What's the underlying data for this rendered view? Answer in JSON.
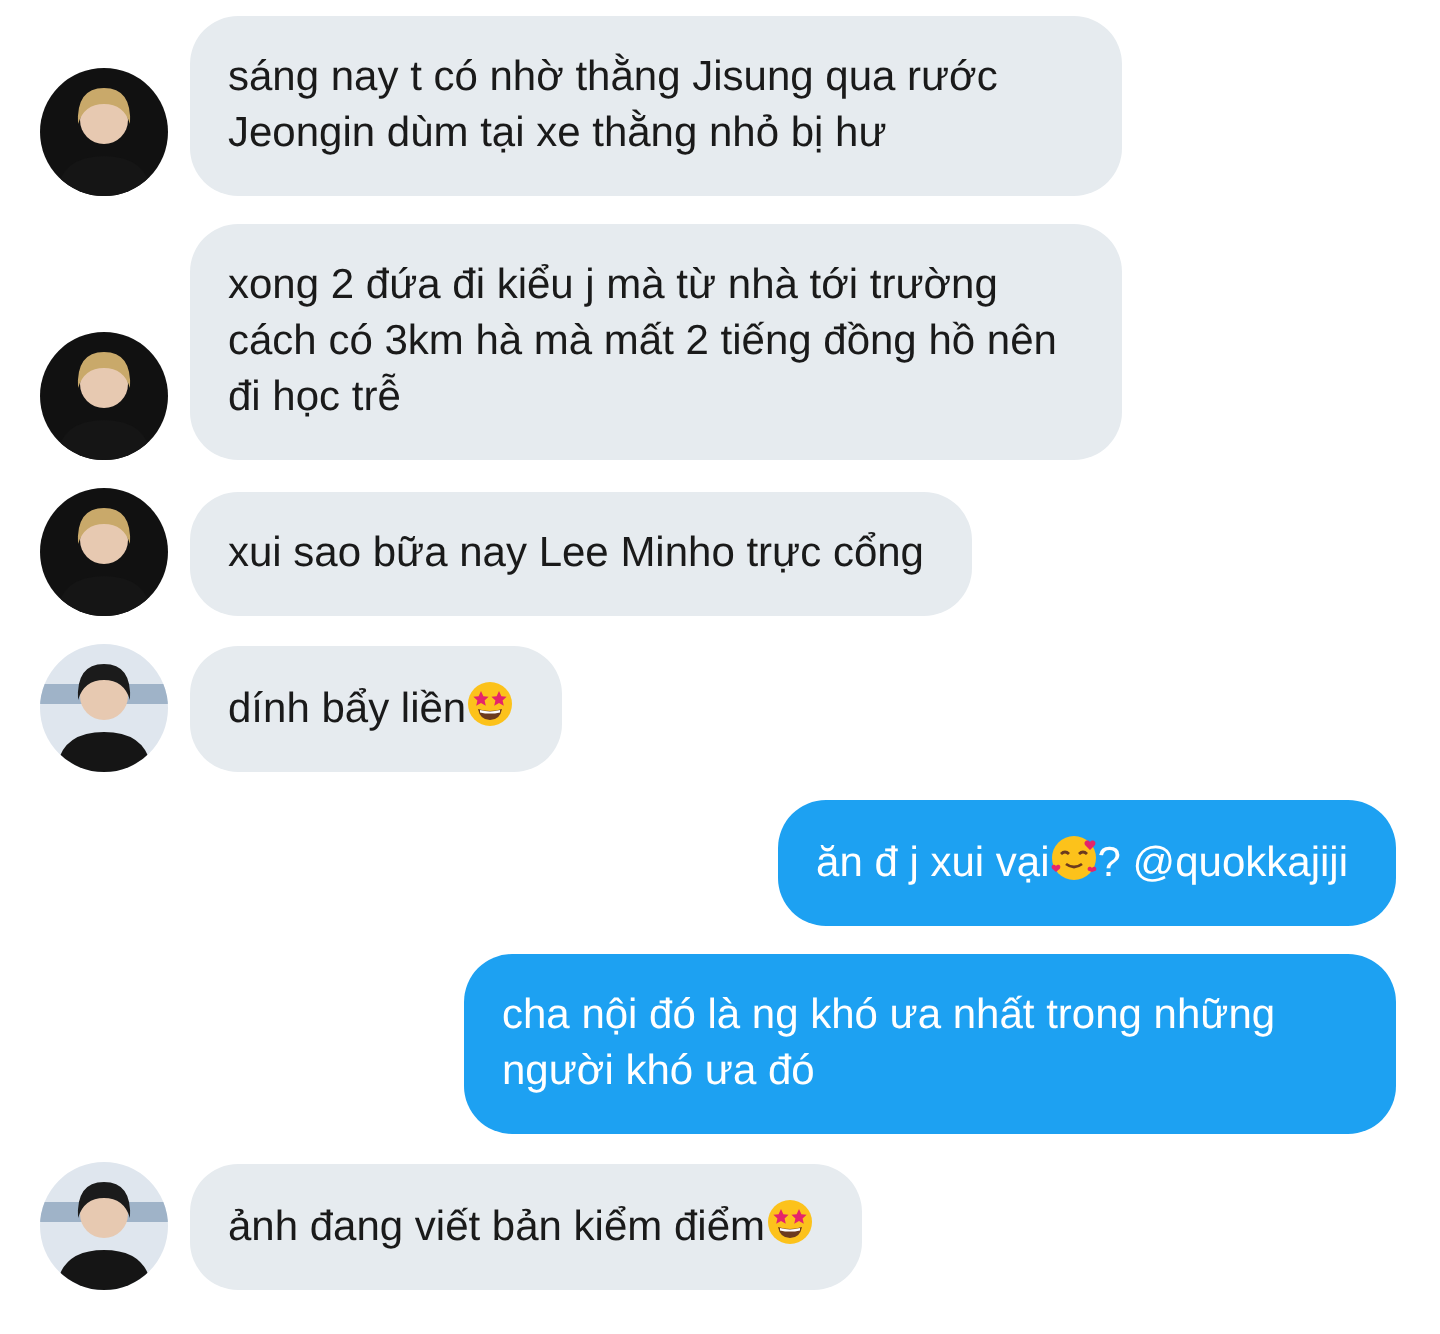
{
  "messages": [
    {
      "kind": "received",
      "avatar": {
        "kind": "blonde"
      },
      "segments": [
        {
          "kind": "text",
          "text": "sáng nay t có nhờ thằng Jisung qua rước Jeongin dùm tại xe thằng nhỏ bị hư"
        }
      ]
    },
    {
      "kind": "received",
      "avatar": {
        "kind": "blonde"
      },
      "segments": [
        {
          "kind": "text",
          "text": "xong 2 đứa đi kiểu j mà từ nhà tới trường cách có 3km hà mà mất 2 tiếng đồng hồ nên đi học trễ"
        }
      ]
    },
    {
      "kind": "received",
      "avatar": {
        "kind": "blonde"
      },
      "segments": [
        {
          "kind": "text",
          "text": "xui sao bữa nay Lee Minho trực cổng"
        }
      ]
    },
    {
      "kind": "received",
      "avatar": {
        "kind": "dark"
      },
      "segments": [
        {
          "kind": "text",
          "text": "dính bẩy liền"
        },
        {
          "kind": "star_struck"
        }
      ]
    },
    {
      "kind": "sent",
      "segments": [
        {
          "kind": "text",
          "text": "ăn đ j xui vại"
        },
        {
          "kind": "hearts"
        },
        {
          "kind": "text",
          "text": "? @quokkajiji"
        }
      ]
    },
    {
      "kind": "sent",
      "segments": [
        {
          "kind": "text",
          "text": "cha nội đó là ng khó ưa nhất trong những người khó ưa đó"
        }
      ]
    },
    {
      "kind": "received",
      "avatar": {
        "kind": "dark"
      },
      "segments": [
        {
          "kind": "text",
          "text": "ảnh đang viết bản kiểm điểm"
        },
        {
          "kind": "star_struck"
        }
      ]
    }
  ]
}
